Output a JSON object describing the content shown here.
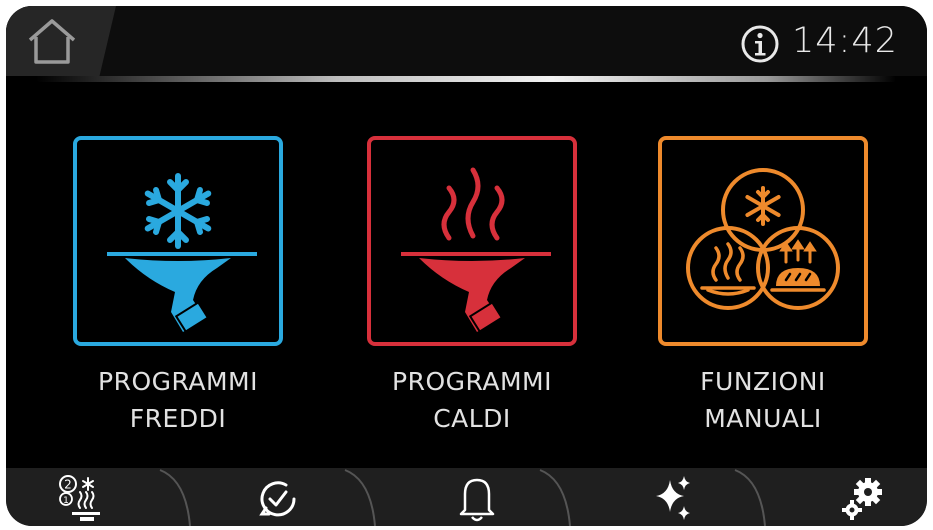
{
  "header": {
    "home_icon": "home-icon",
    "info_icon": "info-icon",
    "time": "14:42"
  },
  "tiles": [
    {
      "line1": "PROGRAMMI",
      "line2": "FREDDI",
      "color": "#2aa9df",
      "icon": "snowflake-tray-icon"
    },
    {
      "line1": "PROGRAMMI",
      "line2": "CALDI",
      "color": "#d7303b",
      "icon": "steam-tray-icon"
    },
    {
      "line1": "FUNZIONI",
      "line2": "MANUALI",
      "color": "#ee8a2c",
      "icon": "manual-functions-icon"
    }
  ],
  "bottom_nav": [
    {
      "icon": "programs-list-icon"
    },
    {
      "icon": "timer-icon"
    },
    {
      "icon": "bell-icon"
    },
    {
      "icon": "sparkle-icon"
    },
    {
      "icon": "settings-gears-icon"
    }
  ]
}
